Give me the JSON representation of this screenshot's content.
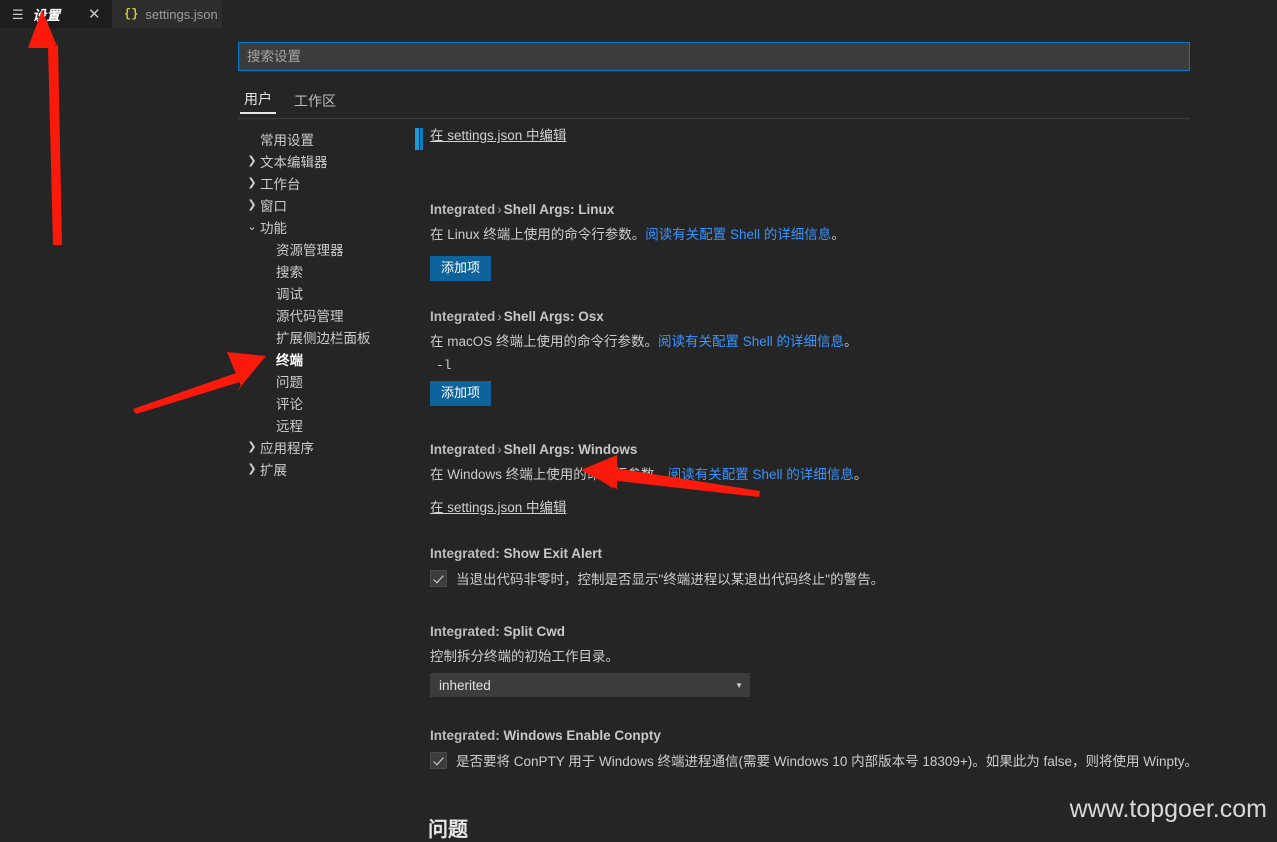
{
  "window": {
    "tabs": [
      {
        "name": "settings-editor-tab",
        "label": "设置",
        "icon": "hamburger-icon",
        "active": true,
        "close_label": "✕"
      },
      {
        "name": "settings-json-tab",
        "label": "settings.json",
        "icon": "json-braces-icon",
        "active": false
      }
    ]
  },
  "search": {
    "placeholder": "搜索设置",
    "value": ""
  },
  "scope_tabs": [
    {
      "label": "用户",
      "selected": true
    },
    {
      "label": "工作区",
      "selected": false
    }
  ],
  "tree": [
    {
      "label": "常用设置",
      "level": 1,
      "twisty": "",
      "bold": false
    },
    {
      "label": "文本编辑器",
      "level": 0,
      "twisty": "❯",
      "bold": false
    },
    {
      "label": "工作台",
      "level": 0,
      "twisty": "❯",
      "bold": false
    },
    {
      "label": "窗口",
      "level": 0,
      "twisty": "❯",
      "bold": false
    },
    {
      "label": "功能",
      "level": 0,
      "twisty": "⌄",
      "bold": false
    },
    {
      "label": "资源管理器",
      "level": 1,
      "twisty": "",
      "bold": false
    },
    {
      "label": "搜索",
      "level": 1,
      "twisty": "",
      "bold": false
    },
    {
      "label": "调试",
      "level": 1,
      "twisty": "",
      "bold": false
    },
    {
      "label": "源代码管理",
      "level": 1,
      "twisty": "",
      "bold": false
    },
    {
      "label": "扩展侧边栏面板",
      "level": 1,
      "twisty": "",
      "bold": false
    },
    {
      "label": "终端",
      "level": 1,
      "twisty": "",
      "bold": true
    },
    {
      "label": "问题",
      "level": 1,
      "twisty": "",
      "bold": false
    },
    {
      "label": "评论",
      "level": 1,
      "twisty": "",
      "bold": false
    },
    {
      "label": "远程",
      "level": 1,
      "twisty": "",
      "bold": false
    },
    {
      "label": "应用程序",
      "level": 0,
      "twisty": "❯",
      "bold": false
    },
    {
      "label": "扩展",
      "level": 0,
      "twisty": "❯",
      "bold": false
    }
  ],
  "settings": {
    "clipped_link": "在 settings.json 中编辑",
    "linux": {
      "category": "Integrated",
      "separator": "›",
      "name_prefix": "Shell Args: ",
      "name": "Linux",
      "desc_before": "在 Linux 终端上使用的命令行参数。",
      "desc_link": "阅读有关配置 Shell 的详细信息",
      "desc_after": "。",
      "button": "添加项"
    },
    "osx": {
      "category": "Integrated",
      "separator": "›",
      "name_prefix": "Shell Args: ",
      "name": "Osx",
      "desc_before": "在 macOS 终端上使用的命令行参数。",
      "desc_link": "阅读有关配置 Shell 的详细信息",
      "desc_after": "。",
      "item_value": "-l",
      "button": "添加项"
    },
    "windows": {
      "category": "Integrated",
      "separator": "›",
      "name_prefix": "Shell Args: ",
      "name": "Windows",
      "desc_before": "在 Windows 终端上使用的命令行参数。",
      "desc_link": "阅读有关配置 Shell 的详细信息",
      "desc_after": "。",
      "edit_link": "在 settings.json 中编辑"
    },
    "show_exit_alert": {
      "category": "Integrated:",
      "name": "Show Exit Alert",
      "checked": true,
      "label": "当退出代码非零时，控制是否显示\"终端进程以某退出代码终止\"的警告。"
    },
    "split_cwd": {
      "category": "Integrated:",
      "name": "Split Cwd",
      "desc": "控制拆分终端的初始工作目录。",
      "value": "inherited",
      "arrow": "▼"
    },
    "windows_enable_conpty": {
      "category": "Integrated:",
      "name": "Windows Enable Conpty",
      "checked": true,
      "label": "是否要将 ConPTY 用于 Windows 终端进程通信(需要 Windows 10 内部版本号 18309+)。如果此为 false，则将使用 Winpty。"
    }
  },
  "section_heading": "问题",
  "watermark": "www.topgoer.com",
  "colors": {
    "accent_blue": "#007acc",
    "button_blue": "#0e639c",
    "link_blue": "#3794ff",
    "modified_bar": "#0e7ec4",
    "editor_bg": "#252526",
    "tab_active_bg": "#1e1e1e",
    "tab_inactive_bg": "#2d2d2d",
    "annotation_red": "#f91a0b"
  }
}
